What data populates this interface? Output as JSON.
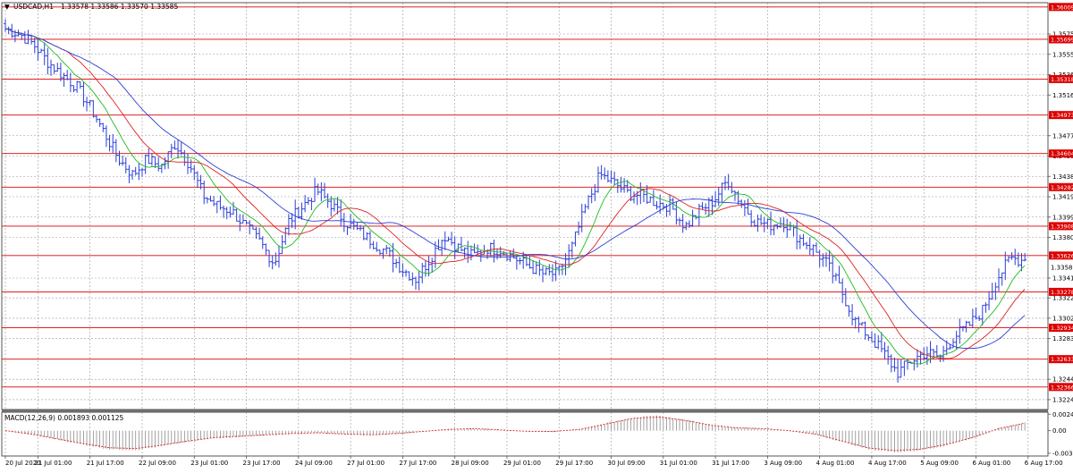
{
  "window": {
    "title": "USDCAD,H1",
    "ohlc": "1.33578 1.33586 1.33570 1.33585"
  },
  "colors": {
    "candle": "#2b3fd6",
    "ma_fast": "#22bb22",
    "ma_mid": "#dd2222",
    "ma_slow": "#2b3fd6",
    "level_line": "#dd0000",
    "level_label_bg": "#dd0000",
    "grid": "#9a9a9a",
    "macd_signal": "#dd2222",
    "macd_hist": "#8c8c8c"
  },
  "chart_data": [
    {
      "type": "candlestick",
      "title": "USDCAD,H1",
      "subtitle": "1.33578 1.33586 1.33570 1.33585",
      "ylim": [
        1.3215,
        1.3605
      ],
      "y_ticks": [
        "1.35750",
        "1.35555",
        "1.35360",
        "1.35165",
        "1.34775",
        "1.34580",
        "1.34385",
        "1.34190",
        "1.33995",
        "1.33800",
        "1.33410",
        "1.33220",
        "1.33025",
        "1.32830",
        "1.32440",
        "1.32245"
      ],
      "y_tick_values": [
        1.3575,
        1.35555,
        1.3536,
        1.35165,
        1.34775,
        1.3458,
        1.34385,
        1.3419,
        1.33995,
        1.338,
        1.3341,
        1.3322,
        1.33025,
        1.3283,
        1.3244,
        1.32245
      ],
      "x_ticks": [
        "20 Jul 2020",
        "21 Jul 01:00",
        "21 Jul 17:00",
        "22 Jul 09:00",
        "23 Jul 01:00",
        "23 Jul 17:00",
        "24 Jul 09:00",
        "27 Jul 01:00",
        "27 Jul 17:00",
        "28 Jul 09:00",
        "29 Jul 01:00",
        "29 Jul 17:00",
        "30 Jul 09:00",
        "31 Jul 01:00",
        "31 Jul 17:00",
        "3 Aug 09:00",
        "4 Aug 01:00",
        "4 Aug 17:00",
        "5 Aug 09:00",
        "6 Aug 01:00",
        "6 Aug 17:00"
      ],
      "x_tick_index": [
        0,
        10,
        26,
        42,
        58,
        74,
        90,
        106,
        122,
        138,
        154,
        170,
        186,
        202,
        218,
        234,
        250,
        266,
        282,
        298,
        314
      ],
      "horizontal_levels": [
        "1.36009",
        "1.35699",
        "1.35318",
        "1.34973",
        "1.34604",
        "1.34282",
        "1.33908",
        "1.33626",
        "1.33278",
        "1.32934",
        "1.32633",
        "1.32366"
      ],
      "level_values": [
        1.36009,
        1.35699,
        1.35318,
        1.34973,
        1.34604,
        1.34282,
        1.33908,
        1.33626,
        1.33278,
        1.32934,
        1.32633,
        1.32366
      ],
      "current_price": "1.33585",
      "current_price_value": 1.33585,
      "price_path_close": [
        1.358,
        1.3575,
        1.3565,
        1.3548,
        1.3536,
        1.3525,
        1.3505,
        1.348,
        1.3455,
        1.344,
        1.3455,
        1.3448,
        1.347,
        1.345,
        1.342,
        1.341,
        1.3405,
        1.339,
        1.3375,
        1.3355,
        1.3395,
        1.341,
        1.3425,
        1.3412,
        1.3395,
        1.3385,
        1.3375,
        1.3365,
        1.335,
        1.334,
        1.336,
        1.3382,
        1.337,
        1.3362,
        1.337,
        1.3368,
        1.336,
        1.3352,
        1.3345,
        1.3345,
        1.337,
        1.341,
        1.344,
        1.3432,
        1.3422,
        1.342,
        1.3413,
        1.341,
        1.339,
        1.3405,
        1.3415,
        1.3435,
        1.3412,
        1.3395,
        1.3392,
        1.3395,
        1.338,
        1.337,
        1.3355,
        1.333,
        1.33,
        1.3285,
        1.327,
        1.325,
        1.3262,
        1.327,
        1.3265,
        1.3285,
        1.3295,
        1.331,
        1.334,
        1.336,
        1.3358
      ]
    },
    {
      "type": "macd",
      "title": "MACD(12,26,9) 0.001893 0.001125",
      "ylim": [
        -0.0037,
        0.0027
      ],
      "y_ticks": [
        "0.002406",
        "0.00",
        "-0.003297"
      ],
      "y_tick_values": [
        0.002406,
        0.0,
        -0.003297
      ],
      "signal_path": [
        0.0,
        -0.0005,
        -0.0012,
        -0.0019,
        -0.0025,
        -0.0026,
        -0.0021,
        -0.0015,
        -0.001,
        -0.0008,
        -0.0006,
        -0.0004,
        -0.0003,
        -0.0005,
        -0.0006,
        -0.0004,
        -0.0001,
        0.0002,
        0.0003,
        0.0001,
        -0.0001,
        -0.0001,
        0.0002,
        0.001,
        0.0018,
        0.002,
        0.0015,
        0.0008,
        0.0004,
        0.0003,
        0.0,
        -0.0005,
        -0.0015,
        -0.0025,
        -0.0029,
        -0.0027,
        -0.002,
        -0.001,
        0.0003,
        0.0011
      ]
    }
  ]
}
